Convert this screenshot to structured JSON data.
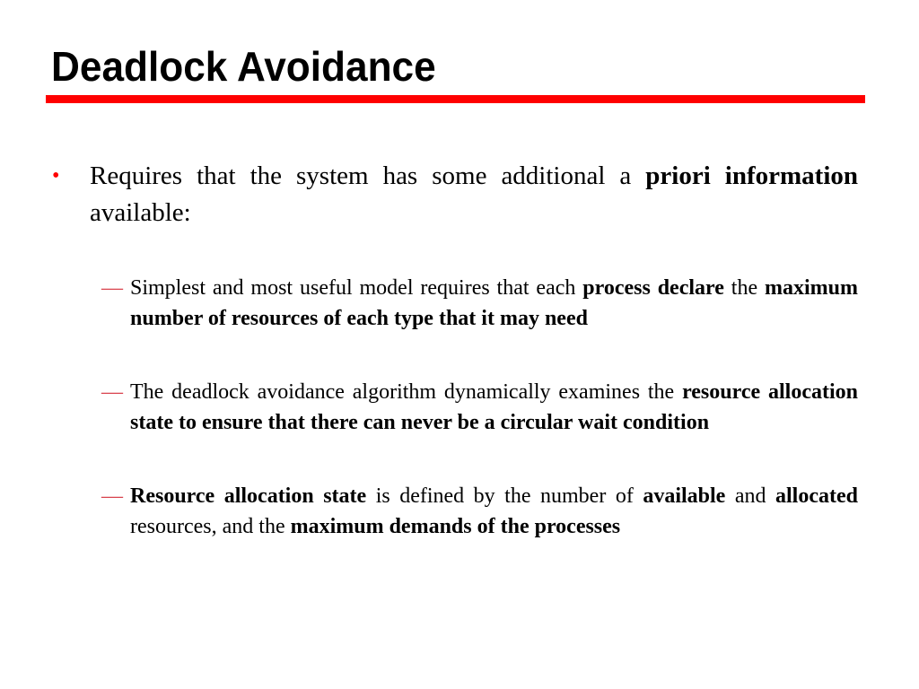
{
  "slide": {
    "title": "Deadlock Avoidance",
    "accent_color": "#ff0000",
    "bullet": {
      "marker": "•",
      "segments": [
        {
          "text": "Requires that the system has some additional a ",
          "bold": false
        },
        {
          "text": "priori information",
          "bold": true
        },
        {
          "text": " available:",
          "bold": false
        }
      ]
    },
    "sub_bullets": [
      {
        "marker": "—",
        "segments": [
          {
            "text": "Simplest and most useful model requires that each ",
            "bold": false
          },
          {
            "text": "process declare",
            "bold": true
          },
          {
            "text": " the ",
            "bold": false
          },
          {
            "text": "maximum number of resources of each type that it may need",
            "bold": true
          }
        ]
      },
      {
        "marker": "—",
        "segments": [
          {
            "text": "The deadlock avoidance algorithm dynamically examines the ",
            "bold": false
          },
          {
            "text": "resource allocation state to ensure that there can never be a circular wait condition",
            "bold": true
          }
        ]
      },
      {
        "marker": "—",
        "segments": [
          {
            "text": "Resource allocation state",
            "bold": true
          },
          {
            "text": " is defined by the number of ",
            "bold": false
          },
          {
            "text": "available",
            "bold": true
          },
          {
            "text": " and ",
            "bold": false
          },
          {
            "text": "allocated",
            "bold": true
          },
          {
            "text": " resources, and the ",
            "bold": false
          },
          {
            "text": "maximum demands of the processes",
            "bold": true
          }
        ]
      }
    ]
  }
}
